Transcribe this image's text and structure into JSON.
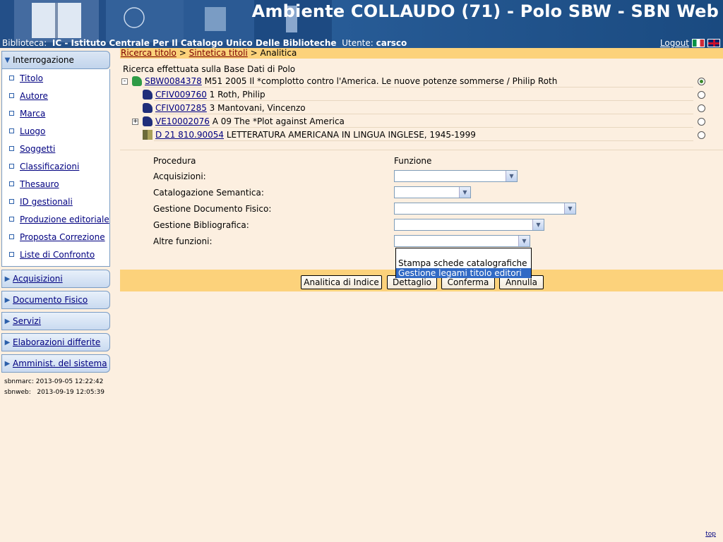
{
  "header": {
    "title": "Ambiente COLLAUDO (71) - Polo SBW - SBN Web",
    "library_label": "Biblioteca:",
    "library_value": "IC - Istituto Centrale Per Il Catalogo Unico Delle Biblioteche",
    "user_label": "Utente:",
    "user_value": "carsco",
    "logout": "Logout"
  },
  "sidebar": {
    "open_menu": "Interrogazione",
    "items": [
      {
        "label": "Titolo"
      },
      {
        "label": "Autore"
      },
      {
        "label": "Marca"
      },
      {
        "label": "Luogo"
      },
      {
        "label": "Soggetti"
      },
      {
        "label": "Classificazioni"
      },
      {
        "label": "Thesauro"
      },
      {
        "label": "ID gestionali"
      },
      {
        "label": "Produzione editoriale"
      },
      {
        "label": "Proposta Correzione"
      },
      {
        "label": "Liste di Confronto"
      }
    ],
    "menus": [
      {
        "label": "Acquisizioni"
      },
      {
        "label": "Documento Fisico"
      },
      {
        "label": "Servizi"
      },
      {
        "label": "Elaborazioni differite"
      },
      {
        "label": "Amminist. del sistema"
      }
    ],
    "stamps": [
      {
        "label": "sbnmarc:",
        "value": "2013-09-05 12:22:42"
      },
      {
        "label": "sbnweb:",
        "value": "2013-09-19 12:05:39"
      }
    ]
  },
  "breadcrumb": {
    "link1": "Ricerca titolo",
    "sep": ">",
    "link2": "Sintetica titoli",
    "current": "Analitica"
  },
  "main": {
    "info": "Ricerca effettuata sulla Base Dati di Polo",
    "tree": [
      {
        "id": "SBW0084378",
        "text": "M51 2005 Il *complotto contro l'America. Le nuove potenze sommerse / Philip Roth",
        "expander": "-",
        "icon": "green-book-icon",
        "selected": true
      },
      {
        "id": "CFIV009760",
        "text": "1 Roth, Philip",
        "expander": "",
        "icon": "author-icon",
        "selected": false
      },
      {
        "id": "CFIV007285",
        "text": "3 Mantovani, Vincenzo",
        "expander": "",
        "icon": "author-icon",
        "selected": false
      },
      {
        "id": "VE10002076",
        "text": "A 09 The *Plot against America",
        "expander": "+",
        "icon": "title-icon",
        "selected": false
      },
      {
        "id": "D 21 810.90054",
        "text": "LETTERATURA AMERICANA IN LINGUA INGLESE, 1945-1999",
        "expander": "",
        "icon": "class-icon",
        "selected": false
      }
    ],
    "form": {
      "col_procedura": "Procedura",
      "col_funzione": "Funzione",
      "rows": [
        {
          "label": "Acquisizioni:",
          "value": ""
        },
        {
          "label": "Catalogazione Semantica:",
          "value": ""
        },
        {
          "label": "Gestione Documento Fisico:",
          "value": ""
        },
        {
          "label": "Gestione Bibliografica:",
          "value": ""
        },
        {
          "label": "Altre funzioni:",
          "value": ""
        }
      ],
      "dropdown_options": [
        {
          "label": ""
        },
        {
          "label": "Stampa schede catalografiche"
        },
        {
          "label": "Gestione legami titolo editori",
          "highlighted": true
        }
      ]
    },
    "buttons": {
      "analitica": "Analitica di Indice",
      "dettaglio": "Dettaglio",
      "conferma": "Conferma",
      "annulla": "Annulla"
    }
  },
  "footer": {
    "top": "top"
  }
}
